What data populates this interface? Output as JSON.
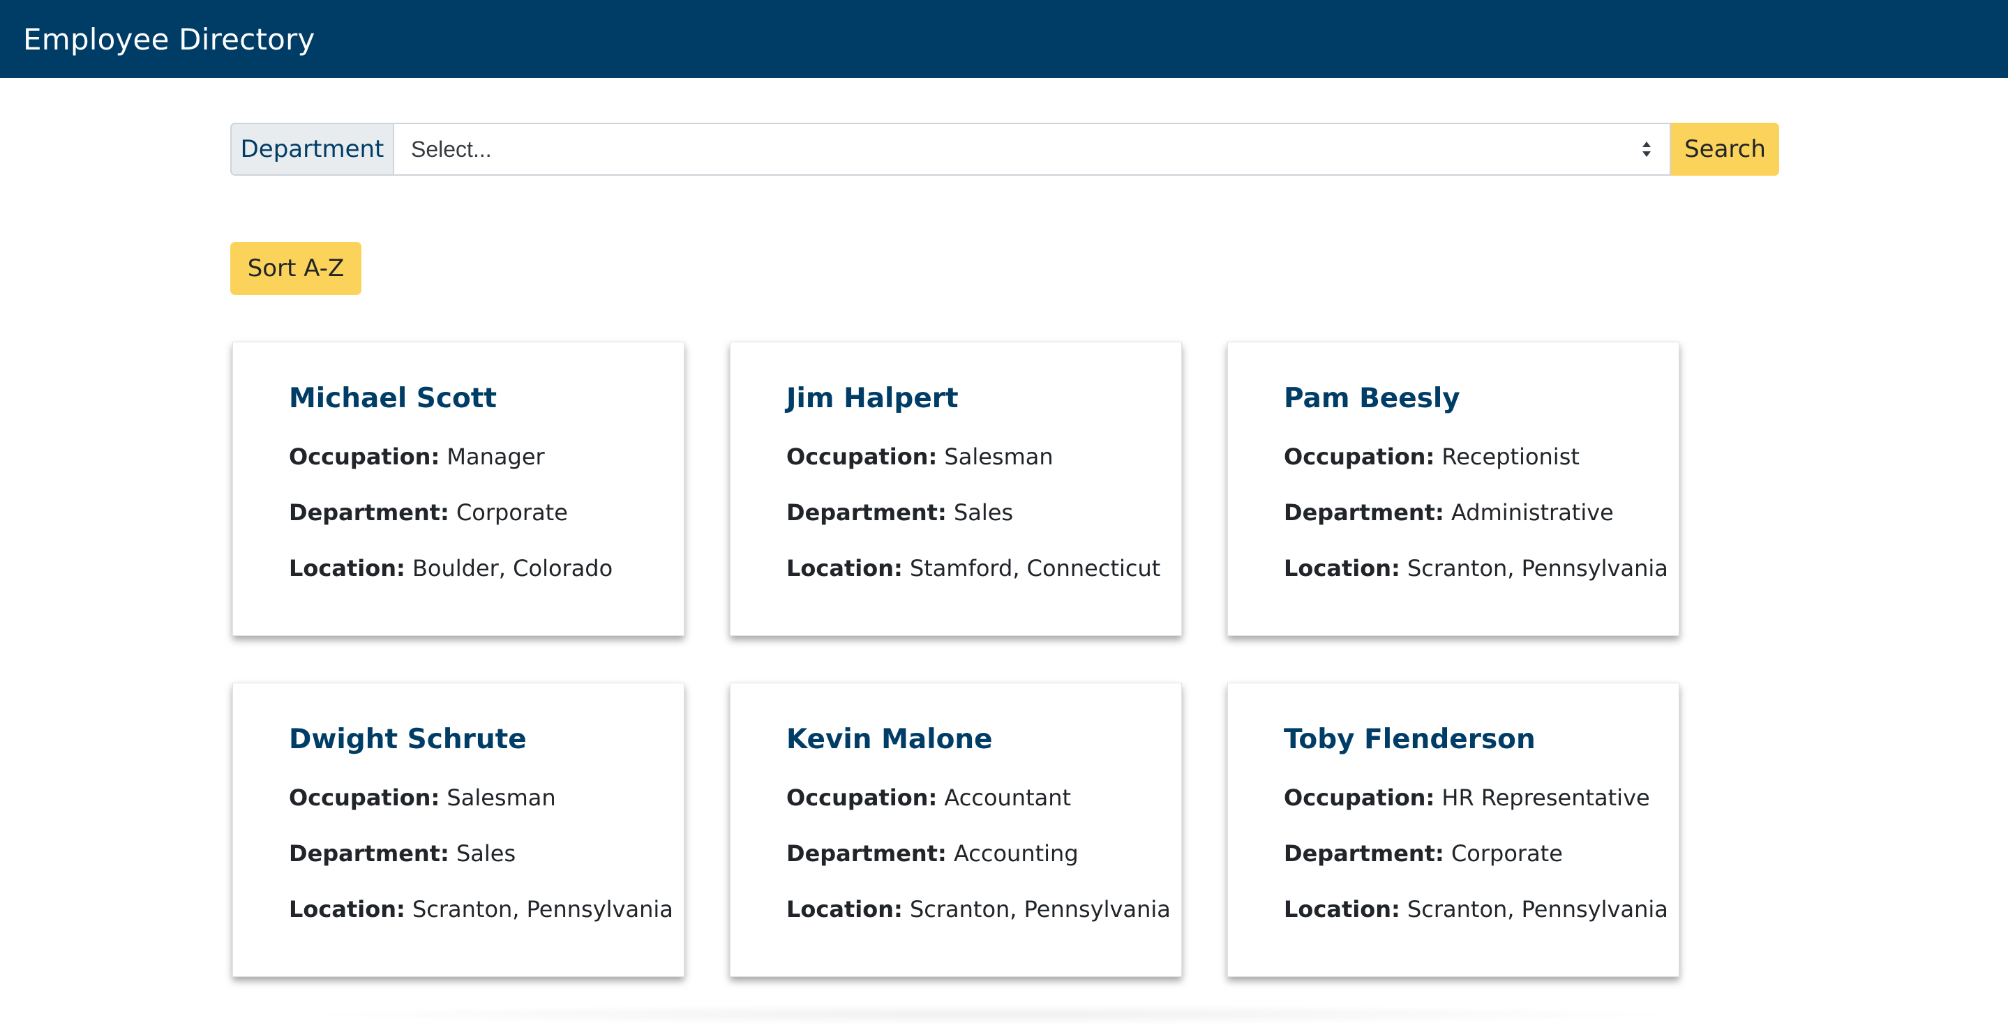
{
  "header": {
    "title": "Employee Directory"
  },
  "filter": {
    "label": "Department",
    "selected": "Select...",
    "search_label": "Search"
  },
  "sort_label": "Sort A-Z",
  "field_labels": {
    "occupation": "Occupation:",
    "department": "Department:",
    "location": "Location:"
  },
  "employees": [
    {
      "name": "Michael Scott",
      "occupation": "Manager",
      "department": "Corporate",
      "location": "Boulder, Colorado"
    },
    {
      "name": "Jim Halpert",
      "occupation": "Salesman",
      "department": "Sales",
      "location": "Stamford, Connecticut"
    },
    {
      "name": "Pam Beesly",
      "occupation": "Receptionist",
      "department": "Administrative",
      "location": "Scranton, Pennsylvania"
    },
    {
      "name": "Dwight Schrute",
      "occupation": "Salesman",
      "department": "Sales",
      "location": "Scranton, Pennsylvania"
    },
    {
      "name": "Kevin Malone",
      "occupation": "Accountant",
      "department": "Accounting",
      "location": "Scranton, Pennsylvania"
    },
    {
      "name": "Toby Flenderson",
      "occupation": "HR Representative",
      "department": "Corporate",
      "location": "Scranton, Pennsylvania"
    }
  ],
  "colors": {
    "navbar": "#003d66",
    "accent_button": "#fcd35a",
    "name_text": "#003d66"
  }
}
